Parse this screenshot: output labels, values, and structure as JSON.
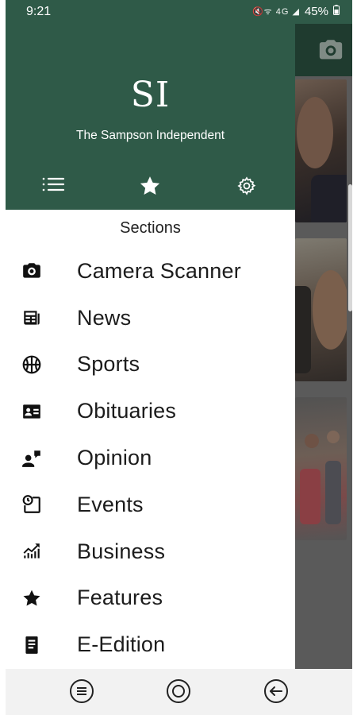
{
  "status_bar": {
    "time": "9:21",
    "icons": "🔇ᯤ 4G ◢",
    "battery": "45%"
  },
  "drawer": {
    "logo": "SI",
    "paper_name": "The Sampson Independent",
    "tabs": [
      {
        "icon": "list-icon",
        "active": false
      },
      {
        "icon": "star-icon",
        "active": true
      },
      {
        "icon": "gear-icon",
        "active": false
      }
    ],
    "sections_title": "Sections",
    "items": [
      {
        "label": "Camera Scanner",
        "icon": "camera-icon"
      },
      {
        "label": "News",
        "icon": "newspaper-icon"
      },
      {
        "label": "Sports",
        "icon": "basketball-icon"
      },
      {
        "label": "Obituaries",
        "icon": "contact-card-icon"
      },
      {
        "label": "Opinion",
        "icon": "person-speech-icon"
      },
      {
        "label": "Events",
        "icon": "calendar-clock-icon"
      },
      {
        "label": "Business",
        "icon": "trending-up-chart-icon"
      },
      {
        "label": "Features",
        "icon": "star-icon"
      },
      {
        "label": "E-Edition",
        "icon": "document-icon"
      }
    ]
  },
  "nav_bar": {
    "buttons": [
      "recent-apps-icon",
      "home-icon",
      "back-icon"
    ]
  },
  "colors": {
    "header_green": "#2f5a48",
    "drawer_bg": "#ffffff",
    "text": "#1c1c1c"
  }
}
